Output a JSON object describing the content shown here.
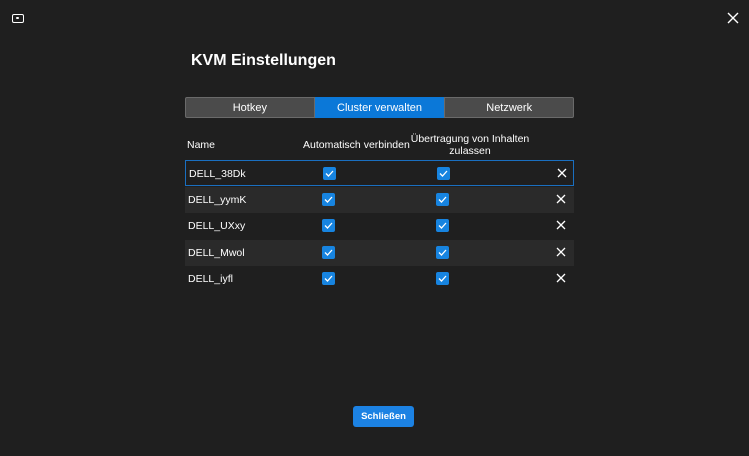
{
  "window": {
    "app_icon": "monitor-icon",
    "close_icon": "close-icon"
  },
  "page": {
    "title": "KVM Einstellungen"
  },
  "tabs": [
    {
      "label": "Hotkey",
      "active": false
    },
    {
      "label": "Cluster verwalten",
      "active": true
    },
    {
      "label": "Netzwerk",
      "active": false
    }
  ],
  "table": {
    "headers": {
      "name": "Name",
      "auto_connect": "Automatisch verbinden",
      "content_transfer": "Übertragung von Inhalten zulassen"
    },
    "rows": [
      {
        "name": "DELL_38Dk",
        "auto_connect": true,
        "content_transfer": true
      },
      {
        "name": "DELL_yymK",
        "auto_connect": true,
        "content_transfer": true
      },
      {
        "name": "DELL_UXxy",
        "auto_connect": true,
        "content_transfer": true
      },
      {
        "name": "DELL_Mwol",
        "auto_connect": true,
        "content_transfer": true
      },
      {
        "name": "DELL_iyfl",
        "auto_connect": true,
        "content_transfer": true
      }
    ]
  },
  "footer": {
    "close_label": "Schließen"
  },
  "colors": {
    "background": "#1f1f1f",
    "accent": "#0b78d8",
    "checkbox": "#1784e0",
    "tab_inactive": "#4b4b4b"
  }
}
